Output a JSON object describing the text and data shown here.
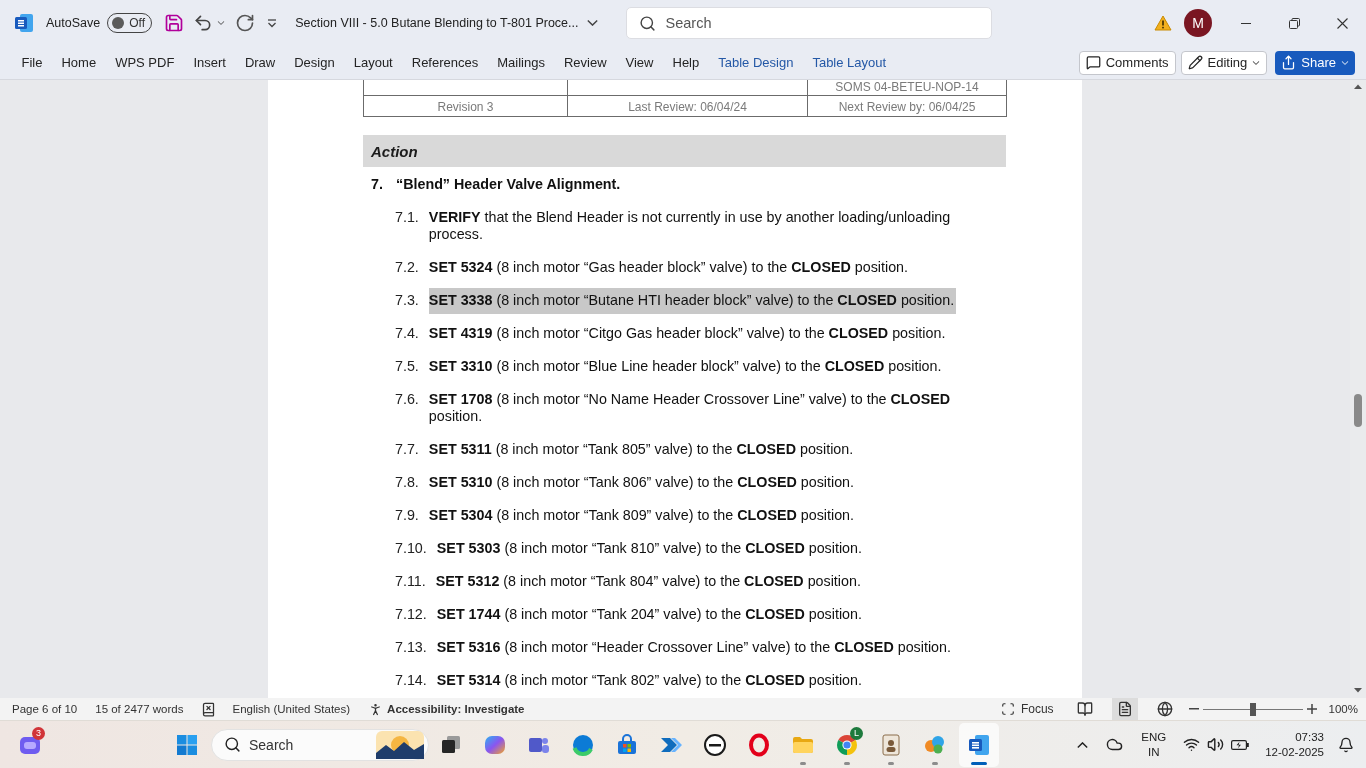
{
  "title_bar": {
    "autosave_label": "AutoSave",
    "autosave": {
      "on": false,
      "label": "Off"
    },
    "document_title": "Section VIII - 5.0 Butane Blending to T-801 Proce...",
    "search": {
      "placeholder": "Search"
    },
    "avatar_initial": "M"
  },
  "ribbon": {
    "tabs": [
      {
        "label": "File",
        "kind": "standard",
        "selected": false
      },
      {
        "label": "Home",
        "kind": "standard",
        "selected": false
      },
      {
        "label": "WPS PDF",
        "kind": "standard",
        "selected": false
      },
      {
        "label": "Insert",
        "kind": "standard",
        "selected": false
      },
      {
        "label": "Draw",
        "kind": "standard",
        "selected": false
      },
      {
        "label": "Design",
        "kind": "standard",
        "selected": false
      },
      {
        "label": "Layout",
        "kind": "standard",
        "selected": false
      },
      {
        "label": "References",
        "kind": "standard",
        "selected": false
      },
      {
        "label": "Mailings",
        "kind": "standard",
        "selected": false
      },
      {
        "label": "Review",
        "kind": "standard",
        "selected": false
      },
      {
        "label": "View",
        "kind": "standard",
        "selected": false
      },
      {
        "label": "Help",
        "kind": "standard",
        "selected": false
      },
      {
        "label": "Table Design",
        "kind": "contextual",
        "selected": false
      },
      {
        "label": "Table Layout",
        "kind": "contextual",
        "selected": false
      }
    ],
    "comments_button": "Comments",
    "editing_button": "Editing",
    "share_button": "Share"
  },
  "document": {
    "header_table": {
      "rows": [
        {
          "column_3": "SOMS 04-BETEU-NOP-14"
        },
        {
          "column_1": "Revision 3",
          "column_2": "Last Review: 06/04/24",
          "column_3": "Next Review by: 06/04/25"
        }
      ]
    },
    "section_heading": "Action",
    "step_group": {
      "number": "7.",
      "title": "“Blend” Header Valve Alignment."
    },
    "steps": [
      {
        "number": "7.1.",
        "text": "**VERIFY** that the Blend Header is not currently in use by another loading/unloading process.",
        "selected": false
      },
      {
        "number": "7.2.",
        "text": "**SET 5324** (8 inch motor “Gas header block” valve) to the **CLOSED** position.",
        "selected": false
      },
      {
        "number": "7.3.",
        "text": "**SET 3338** (8 inch motor “Butane HTI header block” valve) to the **CLOSED** position.",
        "selected": true
      },
      {
        "number": "7.4.",
        "text": "**SET 4319** (8 inch motor “Citgo Gas header block” valve) to the **CLOSED** position.",
        "selected": false
      },
      {
        "number": "7.5.",
        "text": "**SET 3310** (8 inch motor “Blue Line header block” valve) to the **CLOSED** position.",
        "selected": false
      },
      {
        "number": "7.6.",
        "text": "**SET 1708** (8 inch motor “No Name Header Crossover Line” valve) to the **CLOSED** position.",
        "selected": false
      },
      {
        "number": "7.7.",
        "text": "**SET 5311** (8 inch motor “Tank 805” valve) to the **CLOSED** position.",
        "selected": false
      },
      {
        "number": "7.8.",
        "text": "**SET 5310** (8 inch motor “Tank 806” valve) to the **CLOSED** position.",
        "selected": false
      },
      {
        "number": "7.9.",
        "text": "**SET 5304** (8 inch motor “Tank 809” valve) to the **CLOSED** position.",
        "selected": false
      },
      {
        "number": "7.10.",
        "text": "**SET 5303** (8 inch motor “Tank 810” valve) to the **CLOSED** position.",
        "selected": false
      },
      {
        "number": "7.11.",
        "text": "**SET 5312** (8 inch motor “Tank 804” valve) to the **CLOSED** position.",
        "selected": false
      },
      {
        "number": "7.12.",
        "text": "**SET 1744** (8 inch motor “Tank 204” valve) to the **CLOSED** position.",
        "selected": false
      },
      {
        "number": "7.13.",
        "text": "**SET 5316** (8 inch motor “Header Crossover Line” valve) to the **CLOSED** position.",
        "selected": false
      },
      {
        "number": "7.14.",
        "text": "**SET 5314** (8 inch motor “Tank 802” valve) to the **CLOSED** position.",
        "selected": false
      }
    ]
  },
  "status_bar": {
    "page_count": "Page 6 of 10",
    "word_count": "15 of 2477 words",
    "language": "English (United States)",
    "accessibility": "Accessibility: Investigate",
    "focus": "Focus",
    "views": [
      {
        "selected": false
      },
      {
        "selected": true
      },
      {
        "selected": false
      }
    ],
    "zoom": {
      "level": 0.5,
      "reading": "100%"
    }
  },
  "taskbar": {
    "notification_badge": "3",
    "search": {
      "placeholder": "Search"
    },
    "apps": [
      {
        "running": false,
        "active": false
      },
      {
        "running": false,
        "active": false
      },
      {
        "running": false,
        "active": false
      },
      {
        "running": false,
        "active": false
      },
      {
        "running": false,
        "active": false
      },
      {
        "running": false,
        "active": false
      },
      {
        "running": false,
        "active": false
      },
      {
        "running": false,
        "active": false
      },
      {
        "running": true,
        "active": false
      },
      {
        "running": true,
        "active": false,
        "badge": "L"
      },
      {
        "running": true,
        "active": false
      },
      {
        "running": true,
        "active": false
      },
      {
        "running": true,
        "active": true
      }
    ],
    "input_language": {
      "language": "ENG",
      "region": "IN"
    },
    "time": "07:33",
    "date": "12-02-2025"
  }
}
